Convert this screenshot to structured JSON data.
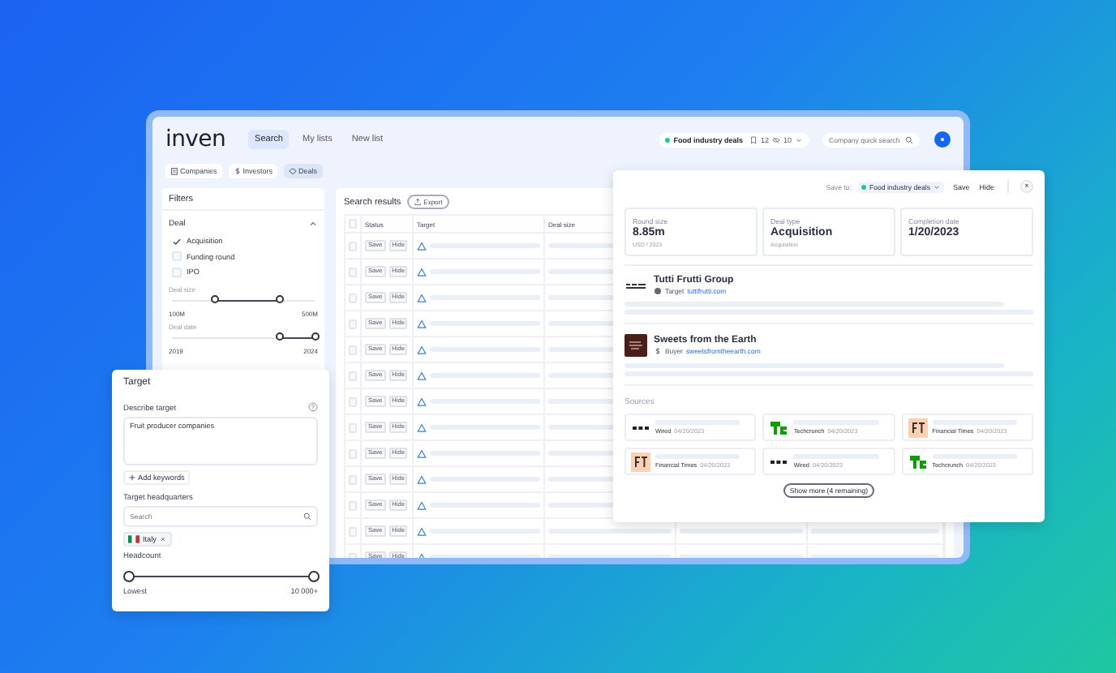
{
  "header": {
    "logo": "inven",
    "tabs": [
      {
        "label": "Search",
        "selected": true
      },
      {
        "label": "My lists",
        "selected": false
      },
      {
        "label": "New list",
        "selected": false
      }
    ],
    "list_pill": {
      "name": "Food industry deals",
      "saved_count": "12",
      "hidden_count": "10"
    },
    "quick_search": {
      "placeholder": "Company quick search"
    }
  },
  "entity_tabs": [
    {
      "label": "Companies",
      "kind": "companies",
      "selected": false
    },
    {
      "label": "Investors",
      "kind": "investors",
      "selected": false
    },
    {
      "label": "Deals",
      "kind": "deals",
      "selected": true
    }
  ],
  "filters": {
    "title": "Filters",
    "section": {
      "title": "Deal",
      "expanded": true,
      "options": [
        {
          "label": "Acquisition",
          "checked": true
        },
        {
          "label": "Funding round",
          "checked": false
        },
        {
          "label": "IPO",
          "checked": false
        }
      ],
      "sliders": [
        {
          "label": "Deal size",
          "thumbs": [
            {
              "level": 0.3
            },
            {
              "level": 0.75
            }
          ],
          "min": "100M",
          "max": "500M"
        },
        {
          "label": "Deal date",
          "thumbs": [
            {
              "level": 0.75
            },
            {
              "level": 1
            }
          ],
          "min": "2019",
          "max": "2024"
        }
      ]
    }
  },
  "results": {
    "title": "Search results",
    "export": "Export",
    "columns": [
      "Status",
      "Target",
      "Deal size"
    ],
    "all_checked": false,
    "rows": [
      {
        "checked": false,
        "save": "Save",
        "hide": "Hide"
      },
      {
        "checked": false,
        "save": "Save",
        "hide": "Hide"
      },
      {
        "checked": false,
        "save": "Save",
        "hide": "Hide"
      },
      {
        "checked": false,
        "save": "Save",
        "hide": "Hide"
      },
      {
        "checked": false,
        "save": "Save",
        "hide": "Hide"
      },
      {
        "checked": false,
        "save": "Save",
        "hide": "Hide"
      },
      {
        "checked": false,
        "save": "Save",
        "hide": "Hide"
      },
      {
        "checked": false,
        "save": "Save",
        "hide": "Hide"
      },
      {
        "checked": false,
        "save": "Save",
        "hide": "Hide"
      },
      {
        "checked": false,
        "save": "Save",
        "hide": "Hide"
      },
      {
        "checked": false,
        "save": "Save",
        "hide": "Hide"
      },
      {
        "checked": false,
        "save": "Save",
        "hide": "Hide"
      },
      {
        "checked": false,
        "save": "Save",
        "hide": "Hide"
      }
    ]
  },
  "deal_card": {
    "save_to_label": "Save to:",
    "list_name": "Food industry deals",
    "save": "Save",
    "hide": "Hide",
    "close": "×",
    "stats": [
      {
        "label": "Round size",
        "value": "8.85m",
        "note": "USD / 2023"
      },
      {
        "label": "Deal type",
        "value": "Acquisition",
        "note": "Acquisition"
      },
      {
        "label": "Completion date",
        "value": "1/20/2023"
      }
    ],
    "companies": [
      {
        "name": "Tutti Frutti Group",
        "kind": "tutti",
        "role": {
          "label": "Target",
          "kind": "target"
        },
        "link": "tuttifrutti.com"
      },
      {
        "name": "Sweets from the Earth",
        "kind": "sweets",
        "role": {
          "label": "Buyer",
          "kind": "buyer"
        },
        "link": "sweetsfromtheearth.com"
      }
    ],
    "sources_title": "Sources",
    "sources": [
      {
        "kind": "wired",
        "name": "Wired",
        "date": "04/20/2023"
      },
      {
        "kind": "techcrunch",
        "name": "Techcrunch",
        "date": "04/20/2023"
      },
      {
        "kind": "ft",
        "name": "Financial Times",
        "date": "04/20/2023"
      },
      {
        "kind": "ft",
        "name": "Financial Times",
        "date": "04/20/2023"
      },
      {
        "kind": "wired",
        "name": "Wired",
        "date": "04/20/2023"
      },
      {
        "kind": "techcrunch",
        "name": "Techcrunch",
        "date": "04/20/2023"
      }
    ],
    "show_more": "Show more (4 remaining)"
  },
  "target_card": {
    "title": "Target",
    "describe_label": "Describe target",
    "describe_value": "Fruit producer companies",
    "add_keywords": "Add keywords",
    "hq_label": "Target headquarters",
    "hq_search": {
      "placeholder": "Search"
    },
    "hq_chips": [
      {
        "label": "Italy",
        "kind": "italy"
      }
    ],
    "headcount": {
      "label": "Headcount",
      "thumbs": [
        {
          "level": 0
        },
        {
          "level": 1
        }
      ],
      "min": "Lowest",
      "max": "10 000+"
    }
  }
}
